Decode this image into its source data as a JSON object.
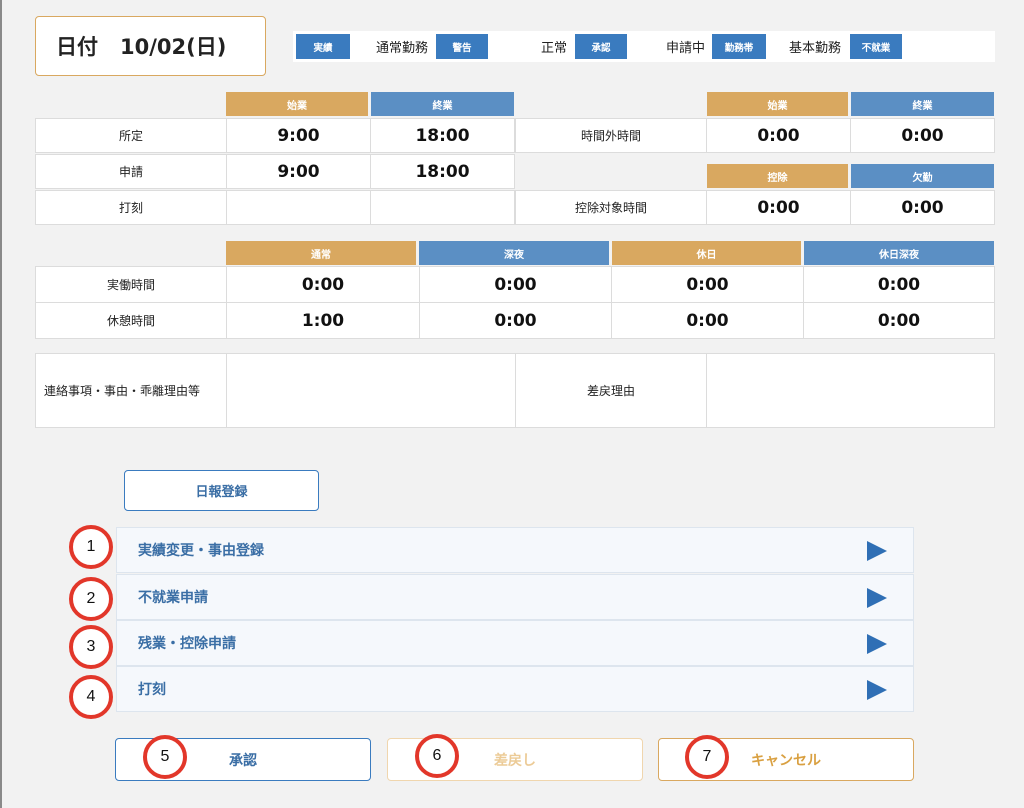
{
  "date": {
    "label": "日付",
    "value": "10/02(日)"
  },
  "status_bar": {
    "items": [
      {
        "badge": "実績",
        "text": "通常勤務"
      },
      {
        "badge": "警告",
        "text": "正常"
      },
      {
        "badge": "承認",
        "text": "申請中"
      },
      {
        "badge": "勤務帯",
        "text": "基本勤務"
      },
      {
        "badge": "不就業",
        "text": ""
      }
    ]
  },
  "schedule": {
    "headers": {
      "start": "始業",
      "end": "終業"
    },
    "rows": [
      {
        "label": "所定",
        "start": "9:00",
        "end": "18:00"
      },
      {
        "label": "申請",
        "start": "9:00",
        "end": "18:00"
      },
      {
        "label": "打刻",
        "start": "",
        "end": ""
      }
    ]
  },
  "overtime": {
    "label": "時間外時間",
    "headers": {
      "start": "始業",
      "end": "終業"
    },
    "start": "0:00",
    "end": "0:00"
  },
  "deduction": {
    "label": "控除対象時間",
    "headers": {
      "deduct": "控除",
      "absence": "欠勤"
    },
    "deduct": "0:00",
    "absence": "0:00"
  },
  "hours": {
    "headers": [
      "通常",
      "深夜",
      "休日",
      "休日深夜"
    ],
    "rows": [
      {
        "label": "実働時間",
        "values": [
          "0:00",
          "0:00",
          "0:00",
          "0:00"
        ]
      },
      {
        "label": "休憩時間",
        "values": [
          "1:00",
          "0:00",
          "0:00",
          "0:00"
        ]
      }
    ]
  },
  "notes": {
    "contact_label": "連絡事項・事由・乖離理由等",
    "contact_value": "",
    "return_label": "差戻理由",
    "return_value": ""
  },
  "daily_report_button": "日報登録",
  "menu": [
    {
      "num": "1",
      "label": "実績変更・事由登録"
    },
    {
      "num": "2",
      "label": "不就業申請"
    },
    {
      "num": "3",
      "label": "残業・控除申請"
    },
    {
      "num": "4",
      "label": "打刻"
    }
  ],
  "buttons": {
    "approve": {
      "num": "5",
      "label": "承認"
    },
    "return": {
      "num": "6",
      "label": "差戻し"
    },
    "cancel": {
      "num": "7",
      "label": "キャンセル"
    }
  },
  "colors": {
    "blue": "#3a7bbf",
    "orange": "#d9a860",
    "red_circle": "#e2372a"
  }
}
